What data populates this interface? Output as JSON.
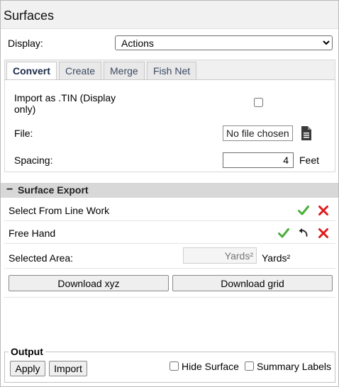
{
  "panel": {
    "title": "Surfaces"
  },
  "display": {
    "label": "Display:",
    "selected": "Actions",
    "options": [
      "Actions"
    ]
  },
  "tabs": [
    {
      "label": "Convert",
      "active": true
    },
    {
      "label": "Create",
      "active": false
    },
    {
      "label": "Merge",
      "active": false
    },
    {
      "label": "Fish Net",
      "active": false
    }
  ],
  "convert": {
    "import_tin_label": "Import as .TIN (Display only)",
    "import_tin_checked": false,
    "file_label": "File:",
    "file_button": "No file chosen",
    "spacing_label": "Spacing:",
    "spacing_value": "4",
    "spacing_unit": "Feet"
  },
  "surface_export": {
    "header": "Surface Export",
    "select_from_line_work": "Select From Line Work",
    "free_hand": "Free Hand",
    "selected_area_label": "Selected Area:",
    "selected_area_placeholder": "Yards²",
    "selected_area_unit": "Yards²",
    "download_xyz": "Download xyz",
    "download_grid": "Download grid"
  },
  "output": {
    "legend": "Output",
    "apply": "Apply",
    "import": "Import",
    "hide_surface": "Hide Surface",
    "summary_labels": "Summary Labels"
  },
  "colors": {
    "check": "#4cae3b",
    "cross": "#e01b1b",
    "section_bg": "#d8d8d8",
    "tab_text": "#3c4a63"
  },
  "icons": {
    "confirm": "check-icon",
    "cancel": "close-icon",
    "undo": "undo-icon",
    "file": "document-icon"
  }
}
